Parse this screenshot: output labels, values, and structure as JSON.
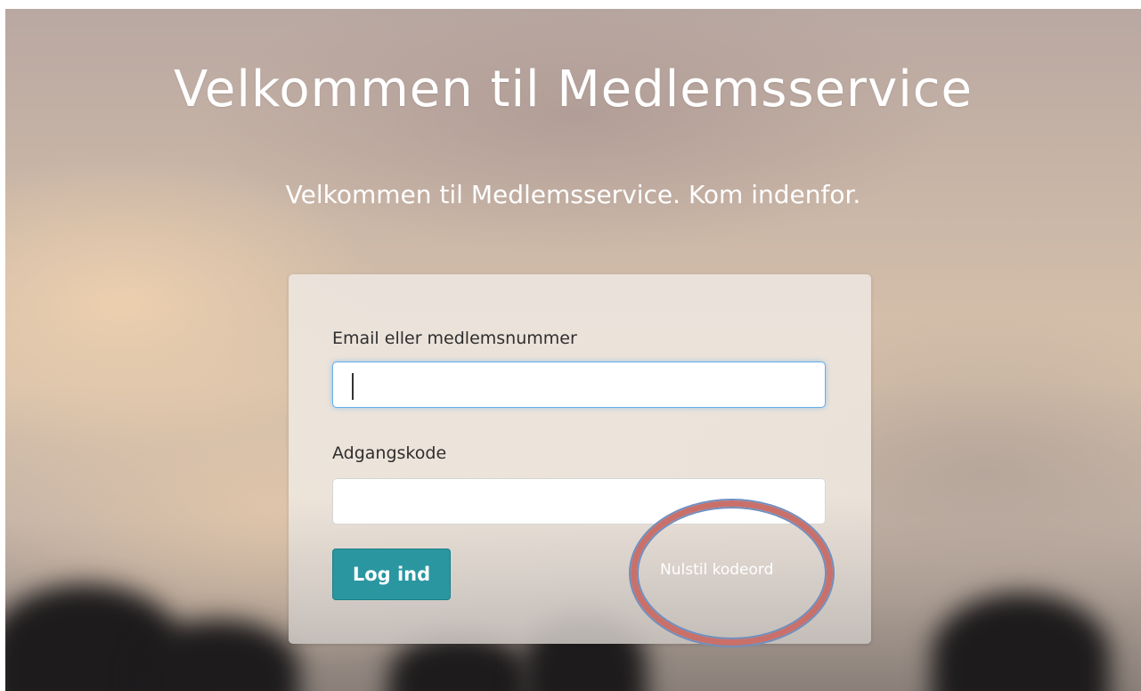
{
  "page": {
    "title": "Velkommen til Medlemsservice",
    "subtitle": "Velkommen til Medlemsservice. Kom indenfor."
  },
  "login_form": {
    "email_label": "Email eller medlemsnummer",
    "email_value": "",
    "password_label": "Adgangskode",
    "password_value": "",
    "submit_label": "Log ind",
    "reset_link_label": "Nulstil kodeord"
  },
  "colors": {
    "button_bg": "#2a96a0",
    "annotation_ring": "#c9706a",
    "input_focus": "#66afe9"
  }
}
